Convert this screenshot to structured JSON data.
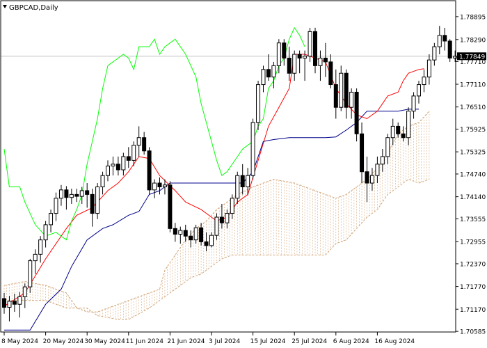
{
  "header": {
    "symbol_label": "GBPCAD,Daily"
  },
  "colors": {
    "background": "#ffffff",
    "candle": "#000000",
    "tenkan": "#ff0000",
    "kijun": "#00008b",
    "chikou": "#00ff00",
    "kumo_edge": "#d2a679",
    "kumo_hatch": "#d2a679",
    "price_line": "#c0c0c0",
    "price_tag_bg": "#000000",
    "price_tag_text": "#ffffff"
  },
  "chart_data": {
    "type": "candlestick",
    "indicator": "Ichimoku",
    "ylim": [
      1.7055,
      1.7915
    ],
    "y_ticks": [
      "1.78895",
      "1.78290",
      "1.77710",
      "1.77110",
      "1.76510",
      "1.75925",
      "1.75325",
      "1.74740",
      "1.74140",
      "1.73555",
      "1.72955",
      "1.72370",
      "1.71770",
      "1.71170",
      "1.70585"
    ],
    "x_ticks": [
      "8 May 2024",
      "20 May 2024",
      "30 May 2024",
      "11 Jun 2024",
      "21 Jun 2024",
      "3 Jul 2024",
      "15 Jul 2024",
      "25 Jul 2024",
      "6 Aug 2024",
      "16 Aug 2024"
    ],
    "x_tick_index": [
      0,
      8,
      16,
      24,
      32,
      40,
      48,
      56,
      64,
      72
    ],
    "current_price": "1.77849",
    "candles": [
      [
        1.7145,
        1.716,
        1.7105,
        1.7122
      ],
      [
        1.7122,
        1.7152,
        1.7085,
        1.7138
      ],
      [
        1.7138,
        1.7158,
        1.711,
        1.713
      ],
      [
        1.713,
        1.7162,
        1.7095,
        1.715
      ],
      [
        1.715,
        1.7185,
        1.712,
        1.7176
      ],
      [
        1.7176,
        1.725,
        1.716,
        1.7245
      ],
      [
        1.7245,
        1.7275,
        1.721,
        1.7262
      ],
      [
        1.7262,
        1.731,
        1.724,
        1.73
      ],
      [
        1.73,
        1.735,
        1.728,
        1.734
      ],
      [
        1.734,
        1.738,
        1.732,
        1.737
      ],
      [
        1.737,
        1.7425,
        1.735,
        1.741
      ],
      [
        1.741,
        1.7445,
        1.739,
        1.7432
      ],
      [
        1.7432,
        1.7442,
        1.738,
        1.7412
      ],
      [
        1.7412,
        1.7435,
        1.7395,
        1.742
      ],
      [
        1.742,
        1.7435,
        1.74,
        1.7415
      ],
      [
        1.7415,
        1.744,
        1.7395,
        1.743
      ],
      [
        1.743,
        1.745,
        1.7385,
        1.742
      ],
      [
        1.742,
        1.7435,
        1.7335,
        1.737
      ],
      [
        1.737,
        1.745,
        1.7355,
        1.744
      ],
      [
        1.744,
        1.748,
        1.742,
        1.747
      ],
      [
        1.747,
        1.751,
        1.7455,
        1.7495
      ],
      [
        1.7495,
        1.752,
        1.747,
        1.75
      ],
      [
        1.75,
        1.752,
        1.747,
        1.7485
      ],
      [
        1.7485,
        1.753,
        1.747,
        1.752
      ],
      [
        1.752,
        1.7545,
        1.749,
        1.751
      ],
      [
        1.751,
        1.756,
        1.7495,
        1.755
      ],
      [
        1.755,
        1.76,
        1.752,
        1.757
      ],
      [
        1.757,
        1.7585,
        1.7525,
        1.7535
      ],
      [
        1.7535,
        1.7545,
        1.742,
        1.7432
      ],
      [
        1.7432,
        1.746,
        1.741,
        1.745
      ],
      [
        1.745,
        1.7465,
        1.742,
        1.744
      ],
      [
        1.744,
        1.746,
        1.742,
        1.7445
      ],
      [
        1.7445,
        1.7455,
        1.732,
        1.733
      ],
      [
        1.733,
        1.7345,
        1.7295,
        1.7315
      ],
      [
        1.7315,
        1.7335,
        1.729,
        1.7325
      ],
      [
        1.7325,
        1.734,
        1.7295,
        1.731
      ],
      [
        1.731,
        1.7325,
        1.728,
        1.73
      ],
      [
        1.73,
        1.734,
        1.729,
        1.7332
      ],
      [
        1.7332,
        1.7345,
        1.7285,
        1.7295
      ],
      [
        1.7295,
        1.732,
        1.727,
        1.7285
      ],
      [
        1.7285,
        1.732,
        1.728,
        1.7312
      ],
      [
        1.7312,
        1.737,
        1.73,
        1.736
      ],
      [
        1.736,
        1.7395,
        1.733,
        1.7345
      ],
      [
        1.7345,
        1.738,
        1.733,
        1.737
      ],
      [
        1.737,
        1.742,
        1.7355,
        1.741
      ],
      [
        1.741,
        1.748,
        1.7395,
        1.747
      ],
      [
        1.747,
        1.75,
        1.742,
        1.744
      ],
      [
        1.744,
        1.749,
        1.742,
        1.747
      ],
      [
        1.747,
        1.762,
        1.746,
        1.761
      ],
      [
        1.761,
        1.772,
        1.759,
        1.771
      ],
      [
        1.771,
        1.776,
        1.769,
        1.775
      ],
      [
        1.775,
        1.779,
        1.772,
        1.773
      ],
      [
        1.773,
        1.777,
        1.77,
        1.776
      ],
      [
        1.776,
        1.783,
        1.774,
        1.782
      ],
      [
        1.782,
        1.783,
        1.776,
        1.778
      ],
      [
        1.778,
        1.781,
        1.772,
        1.774
      ],
      [
        1.774,
        1.78,
        1.772,
        1.779
      ],
      [
        1.779,
        1.78,
        1.774,
        1.778
      ],
      [
        1.778,
        1.78,
        1.772,
        1.7785
      ],
      [
        1.7785,
        1.786,
        1.777,
        1.785
      ],
      [
        1.785,
        1.786,
        1.774,
        1.776
      ],
      [
        1.776,
        1.78,
        1.772,
        1.778
      ],
      [
        1.778,
        1.782,
        1.773,
        1.777
      ],
      [
        1.777,
        1.779,
        1.77,
        1.771
      ],
      [
        1.771,
        1.775,
        1.762,
        1.765
      ],
      [
        1.765,
        1.776,
        1.764,
        1.774
      ],
      [
        1.774,
        1.775,
        1.762,
        1.765
      ],
      [
        1.765,
        1.77,
        1.762,
        1.769
      ],
      [
        1.769,
        1.77,
        1.756,
        1.758
      ],
      [
        1.758,
        1.761,
        1.745,
        1.748
      ],
      [
        1.748,
        1.752,
        1.74,
        1.745
      ],
      [
        1.745,
        1.749,
        1.743,
        1.747
      ],
      [
        1.747,
        1.752,
        1.745,
        1.75
      ],
      [
        1.75,
        1.754,
        1.748,
        1.752
      ],
      [
        1.752,
        1.758,
        1.75,
        1.757
      ],
      [
        1.757,
        1.762,
        1.755,
        1.76
      ],
      [
        1.76,
        1.761,
        1.757,
        1.758
      ],
      [
        1.758,
        1.76,
        1.756,
        1.757
      ],
      [
        1.757,
        1.765,
        1.755,
        1.764
      ],
      [
        1.764,
        1.769,
        1.762,
        1.768
      ],
      [
        1.768,
        1.772,
        1.766,
        1.771
      ],
      [
        1.771,
        1.775,
        1.769,
        1.773
      ],
      [
        1.773,
        1.779,
        1.771,
        1.7775
      ],
      [
        1.7775,
        1.782,
        1.776,
        1.781
      ],
      [
        1.781,
        1.7865,
        1.779,
        1.784
      ],
      [
        1.784,
        1.786,
        1.78,
        1.7825
      ],
      [
        1.7825,
        1.783,
        1.777,
        1.778
      ],
      [
        1.778,
        1.78,
        1.777,
        1.7785
      ]
    ],
    "tenkan": [
      [
        0,
        1.7125
      ],
      [
        4,
        1.716
      ],
      [
        8,
        1.725
      ],
      [
        12,
        1.733
      ],
      [
        14,
        1.7365
      ],
      [
        17,
        1.7385
      ],
      [
        20,
        1.743
      ],
      [
        22,
        1.745
      ],
      [
        24,
        1.748
      ],
      [
        26,
        1.752
      ],
      [
        28,
        1.7515
      ],
      [
        30,
        1.747
      ],
      [
        33,
        1.743
      ],
      [
        35,
        1.74
      ],
      [
        38,
        1.738
      ],
      [
        41,
        1.735
      ],
      [
        43,
        1.736
      ],
      [
        45,
        1.74
      ],
      [
        47,
        1.742
      ],
      [
        49,
        1.751
      ],
      [
        51,
        1.76
      ],
      [
        53,
        1.765
      ],
      [
        55,
        1.77
      ],
      [
        56,
        1.779
      ],
      [
        58,
        1.779
      ],
      [
        60,
        1.778
      ],
      [
        62,
        1.777
      ],
      [
        64,
        1.77
      ],
      [
        66,
        1.766
      ],
      [
        68,
        1.763
      ],
      [
        70,
        1.762
      ],
      [
        72,
        1.764
      ],
      [
        73,
        1.766
      ],
      [
        74,
        1.768
      ],
      [
        76,
        1.769
      ],
      [
        77,
        1.772
      ],
      [
        78,
        1.774
      ],
      [
        80,
        1.775
      ],
      [
        81,
        1.7752
      ]
    ],
    "kijun": [
      [
        0,
        1.7062
      ],
      [
        5,
        1.7062
      ],
      [
        8,
        1.713
      ],
      [
        11,
        1.717
      ],
      [
        13,
        1.723
      ],
      [
        16,
        1.73
      ],
      [
        19,
        1.733
      ],
      [
        21,
        1.734
      ],
      [
        24,
        1.7365
      ],
      [
        26,
        1.7375
      ],
      [
        28,
        1.742
      ],
      [
        30,
        1.743
      ],
      [
        32,
        1.745
      ],
      [
        44,
        1.745
      ],
      [
        46,
        1.745
      ],
      [
        48,
        1.748
      ],
      [
        49,
        1.752
      ],
      [
        50,
        1.756
      ],
      [
        52,
        1.7565
      ],
      [
        55,
        1.757
      ],
      [
        60,
        1.757
      ],
      [
        62,
        1.757
      ],
      [
        64,
        1.7572
      ],
      [
        66,
        1.759
      ],
      [
        68,
        1.761
      ],
      [
        70,
        1.764
      ],
      [
        72,
        1.764
      ],
      [
        76,
        1.764
      ],
      [
        78,
        1.7645
      ],
      [
        80,
        1.7645
      ]
    ],
    "senkou_a": [
      [
        0,
        1.718
      ],
      [
        4,
        1.719
      ],
      [
        8,
        1.718
      ],
      [
        12,
        1.716
      ],
      [
        14,
        1.712
      ],
      [
        16,
        1.711
      ],
      [
        18,
        1.711
      ],
      [
        20,
        1.712
      ],
      [
        22,
        1.713
      ],
      [
        24,
        1.714
      ],
      [
        26,
        1.715
      ],
      [
        28,
        1.716
      ],
      [
        30,
        1.717
      ],
      [
        31,
        1.722
      ],
      [
        33,
        1.726
      ],
      [
        35,
        1.73
      ],
      [
        37,
        1.733
      ],
      [
        39,
        1.735
      ],
      [
        41,
        1.738
      ],
      [
        43,
        1.74
      ],
      [
        45,
        1.742
      ],
      [
        48,
        1.744
      ],
      [
        50,
        1.745
      ],
      [
        52,
        1.746
      ],
      [
        54,
        1.7455
      ],
      [
        56,
        1.745
      ],
      [
        58,
        1.744
      ],
      [
        60,
        1.743
      ],
      [
        62,
        1.742
      ],
      [
        64,
        1.741
      ],
      [
        66,
        1.742
      ],
      [
        68,
        1.744
      ],
      [
        70,
        1.746
      ],
      [
        72,
        1.749
      ],
      [
        74,
        1.753
      ],
      [
        76,
        1.758
      ],
      [
        78,
        1.76
      ],
      [
        80,
        1.761
      ],
      [
        82,
        1.764
      ]
    ],
    "senkou_b": [
      [
        0,
        1.714
      ],
      [
        4,
        1.714
      ],
      [
        8,
        1.714
      ],
      [
        10,
        1.713
      ],
      [
        12,
        1.712
      ],
      [
        16,
        1.712
      ],
      [
        18,
        1.71
      ],
      [
        22,
        1.709
      ],
      [
        24,
        1.709
      ],
      [
        28,
        1.712
      ],
      [
        30,
        1.714
      ],
      [
        32,
        1.716
      ],
      [
        34,
        1.718
      ],
      [
        36,
        1.72
      ],
      [
        38,
        1.721
      ],
      [
        40,
        1.723
      ],
      [
        42,
        1.725
      ],
      [
        44,
        1.726
      ],
      [
        52,
        1.726
      ],
      [
        60,
        1.726
      ],
      [
        62,
        1.726
      ],
      [
        64,
        1.729
      ],
      [
        66,
        1.73
      ],
      [
        68,
        1.733
      ],
      [
        70,
        1.736
      ],
      [
        72,
        1.738
      ],
      [
        74,
        1.742
      ],
      [
        76,
        1.744
      ],
      [
        78,
        1.746
      ],
      [
        80,
        1.745
      ],
      [
        82,
        1.746
      ]
    ],
    "chikou": [
      [
        0,
        1.754
      ],
      [
        1,
        1.744
      ],
      [
        3,
        1.744
      ],
      [
        4,
        1.74
      ],
      [
        6,
        1.734
      ],
      [
        8,
        1.731
      ],
      [
        10,
        1.732
      ],
      [
        12,
        1.73
      ],
      [
        13,
        1.735
      ],
      [
        14,
        1.738
      ],
      [
        15,
        1.742
      ],
      [
        16,
        1.75
      ],
      [
        17,
        1.756
      ],
      [
        18,
        1.762
      ],
      [
        19,
        1.77
      ],
      [
        20,
        1.776
      ],
      [
        22,
        1.778
      ],
      [
        23,
        1.779
      ],
      [
        24,
        1.778
      ],
      [
        25,
        1.775
      ],
      [
        26,
        1.781
      ],
      [
        28,
        1.781
      ],
      [
        29,
        1.783
      ],
      [
        30,
        1.779
      ],
      [
        31,
        1.781
      ],
      [
        33,
        1.783
      ],
      [
        35,
        1.779
      ],
      [
        37,
        1.773
      ],
      [
        38,
        1.766
      ],
      [
        40,
        1.756
      ],
      [
        41,
        1.751
      ],
      [
        42,
        1.747
      ],
      [
        43,
        1.748
      ],
      [
        45,
        1.752
      ],
      [
        46,
        1.754
      ],
      [
        48,
        1.756
      ],
      [
        49,
        1.76
      ],
      [
        50,
        1.762
      ],
      [
        51,
        1.77
      ],
      [
        52,
        1.772
      ],
      [
        53,
        1.776
      ],
      [
        54,
        1.778
      ],
      [
        55,
        1.783
      ],
      [
        56,
        1.786
      ],
      [
        57,
        1.784
      ],
      [
        58,
        1.781
      ]
    ]
  }
}
